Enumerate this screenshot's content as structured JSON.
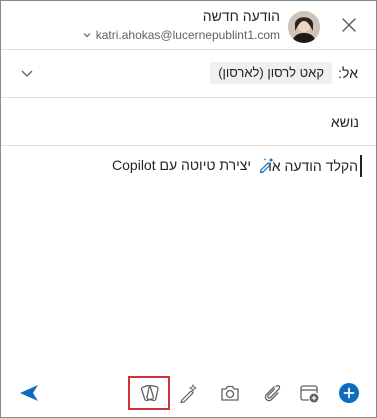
{
  "header": {
    "title": "הודעה חדשה",
    "sender_email": "katri.ahokas@lucernepublint1.com"
  },
  "to_row": {
    "label": "אל:",
    "recipient": "קאט לרסון (לארסון)"
  },
  "subject_row": {
    "label": "נושא"
  },
  "body": {
    "prompt_text": "הקלד הודעה או",
    "copilot_link": "יצירת טיוטה עם Copilot"
  },
  "colors": {
    "accent": "#0f6cbd",
    "highlight": "#d13438",
    "icon_gray": "#616161"
  },
  "toolbar": {
    "icons": [
      "send-icon",
      "loop-icon",
      "pen-sparkle-icon",
      "camera-icon",
      "attach-icon",
      "calendar-add-icon",
      "more-plus-icon"
    ]
  }
}
